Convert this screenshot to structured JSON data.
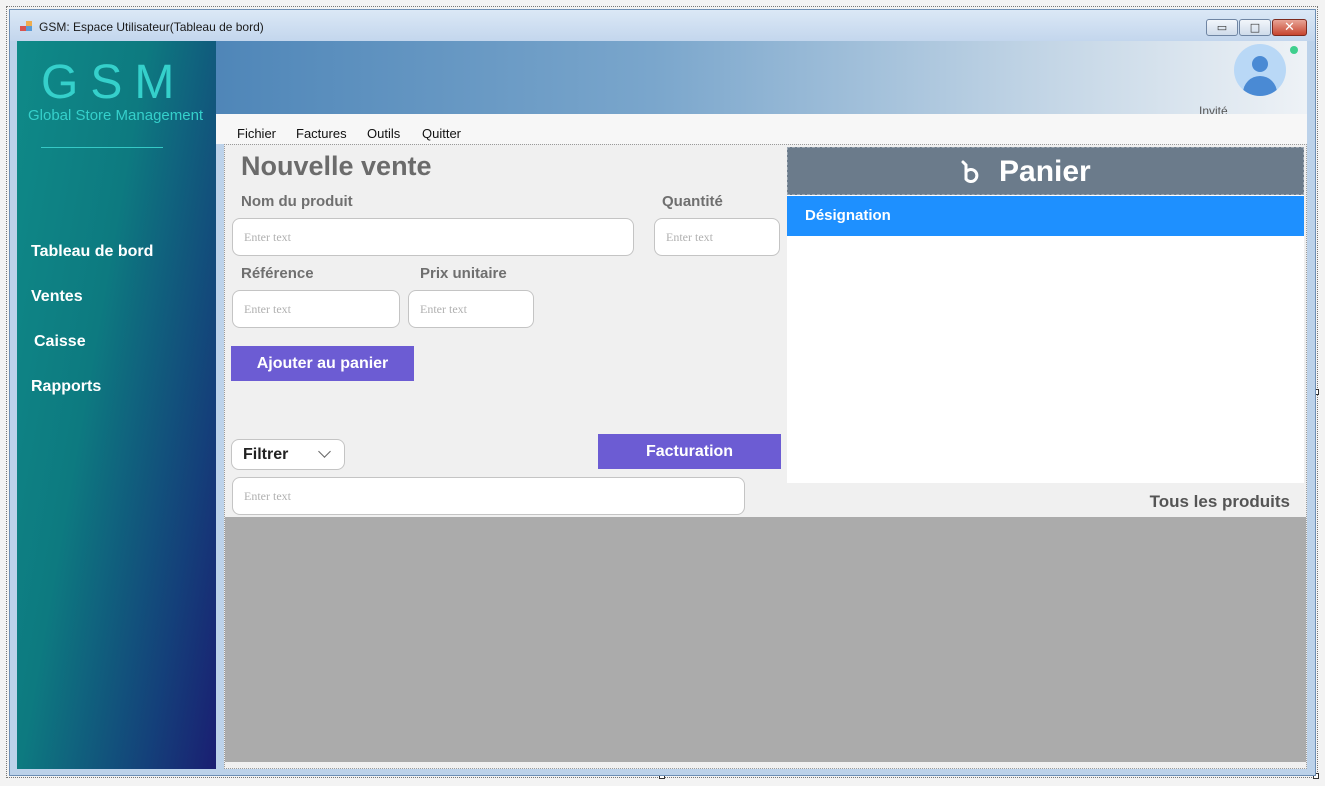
{
  "window": {
    "title": "GSM: Espace Utilisateur(Tableau de bord)",
    "controls": {
      "minimize": "▭",
      "maximize": "□",
      "close": "✕"
    }
  },
  "sidebar": {
    "logo_title": "GSM",
    "logo_subtitle": "Global Store Management",
    "items": [
      {
        "label": "Tableau de bord"
      },
      {
        "label": "Ventes"
      },
      {
        "label": "Caisse"
      },
      {
        "label": "Rapports"
      }
    ]
  },
  "header": {
    "user_label": "Invité",
    "avatar_icon": "user-avatar-icon",
    "status_color": "#3fcf8e"
  },
  "menu": {
    "items": [
      {
        "label": "Fichier"
      },
      {
        "label": "Factures"
      },
      {
        "label": "Outils"
      },
      {
        "label": "Quitter"
      }
    ]
  },
  "sale_form": {
    "title": "Nouvelle vente",
    "product_name_label": "Nom du produit",
    "quantity_label": "Quantité",
    "reference_label": "Référence",
    "unit_price_label": "Prix unitaire",
    "input_placeholder": "Enter text",
    "add_to_cart_label": "Ajouter au panier",
    "filter_label": "Filtrer",
    "invoice_label": "Facturation"
  },
  "cart": {
    "title": "Panier",
    "icon": "cart-icon",
    "column_designation": "Désignation"
  },
  "products": {
    "title": "Tous les produits"
  },
  "colors": {
    "accent_button": "#6c5cd3",
    "cart_header": "#6b7b8b",
    "cart_column": "#1e90ff",
    "logo": "#35d0cb"
  }
}
